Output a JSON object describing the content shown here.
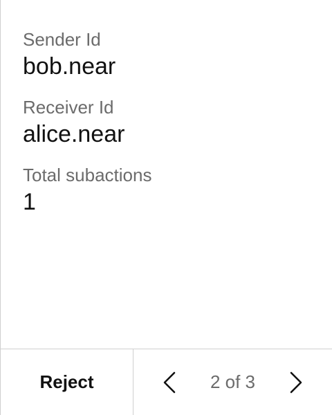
{
  "details": {
    "sender_label": "Sender Id",
    "sender_value": "bob.near",
    "receiver_label": "Receiver Id",
    "receiver_value": "alice.near",
    "subactions_label": "Total subactions",
    "subactions_value": "1"
  },
  "footer": {
    "reject_label": "Reject",
    "pager_text": "2 of 3",
    "prev_icon": "chevron-left-icon",
    "next_icon": "chevron-right-icon"
  }
}
